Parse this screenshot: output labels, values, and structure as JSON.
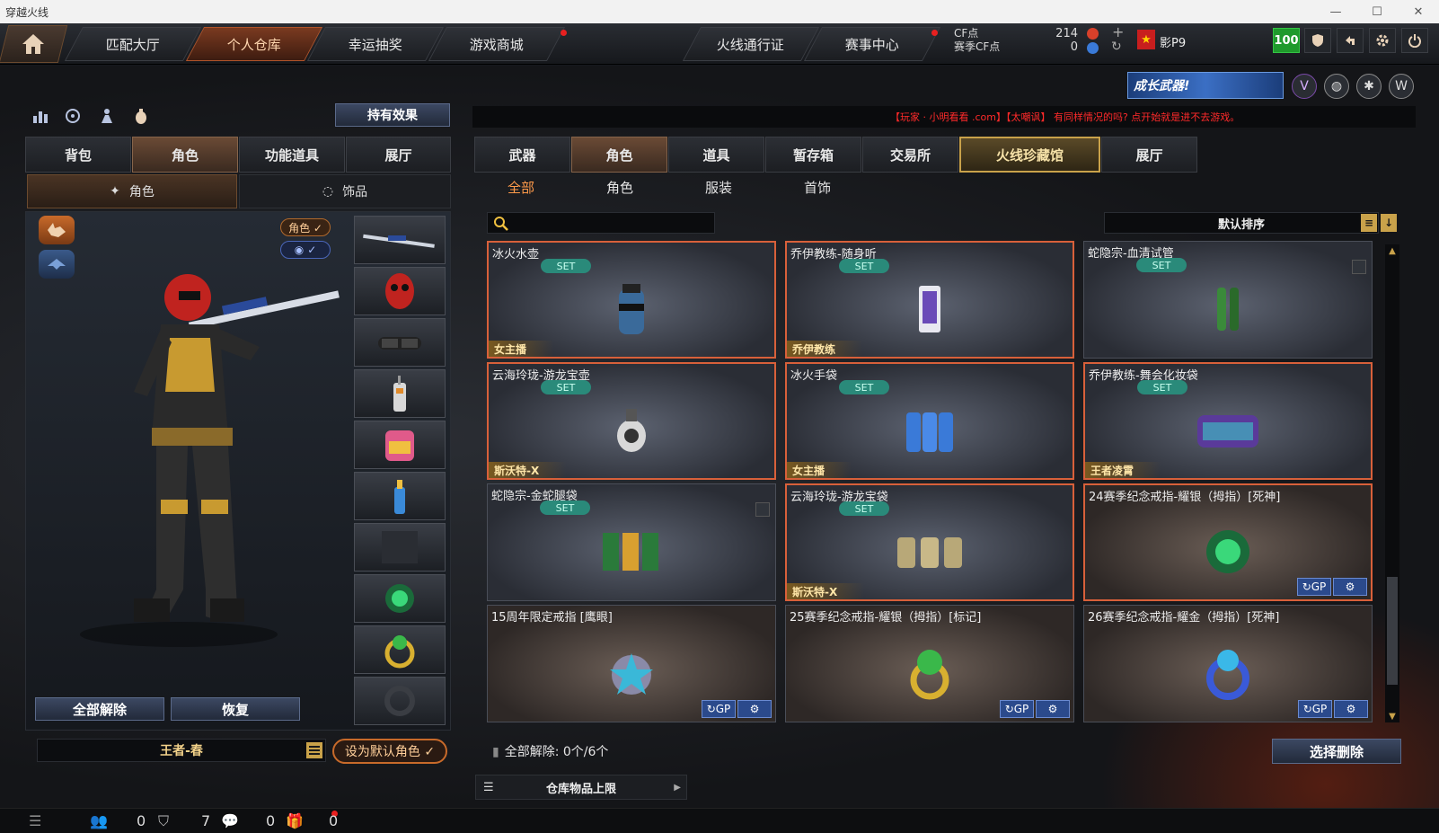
{
  "window": {
    "title": "穿越火线"
  },
  "topnav": {
    "tabs": [
      "匹配大厅",
      "个人仓库",
      "幸运抽奖",
      "游戏商城",
      "火线通行证",
      "赛事中心"
    ],
    "cf_label": "CF点",
    "season_cf_label": "赛季CF点",
    "cf_value": "214",
    "season_cf_value": "0",
    "rank_name": "影P9",
    "level": "100"
  },
  "left": {
    "hold_effect": "持有效果",
    "tabs": [
      "背包",
      "角色",
      "功能道具",
      "展厅"
    ],
    "subtabs": [
      "角色",
      "饰品"
    ],
    "badge_role": "角色 ✓",
    "badge_view": "✓",
    "release_all": "全部解除",
    "restore": "恢复",
    "character_name": "王者-春",
    "set_default": "设为默认角色 ✓"
  },
  "right": {
    "banner": "成长武器!",
    "marquee": "【玩家 · 小明看看 .com】【太嘲讽】 有同样情况的吗? 点开始就是进不去游戏。",
    "tabs": [
      "武器",
      "角色",
      "道具",
      "暂存箱",
      "交易所",
      "火线珍藏馆",
      "展厅"
    ],
    "subtabs": [
      "全部",
      "角色",
      "服装",
      "首饰"
    ],
    "sort_label": "默认排序",
    "release_status": "全部解除: 0个/6个",
    "choose_delete": "选择删除",
    "capacity": "仓库物品上限"
  },
  "items": [
    {
      "name": "冰火水壶",
      "set": "SET",
      "owner": "女主播"
    },
    {
      "name": "乔伊教练-随身听",
      "set": "SET",
      "owner": "乔伊教练"
    },
    {
      "name": "蛇隐宗-血清试管",
      "set": "SET",
      "owner": ""
    },
    {
      "name": "云海玲珑-游龙宝壶",
      "set": "SET",
      "owner": "斯沃特-X"
    },
    {
      "name": "冰火手袋",
      "set": "SET",
      "owner": "女主播"
    },
    {
      "name": "乔伊教练-舞会化妆袋",
      "set": "SET",
      "owner": "王者凌霄"
    },
    {
      "name": "蛇隐宗-金蛇腿袋",
      "set": "SET",
      "owner": ""
    },
    {
      "name": "云海玲珑-游龙宝袋",
      "set": "SET",
      "owner": "斯沃特-X"
    },
    {
      "name": "24赛季纪念戒指-耀银（拇指）[死神]",
      "set": "",
      "owner": ""
    },
    {
      "name": "15周年限定戒指 [鹰眼]",
      "set": "",
      "owner": ""
    },
    {
      "name": "25赛季纪念戒指-耀银（拇指）[标记]",
      "set": "",
      "owner": ""
    },
    {
      "name": "26赛季纪念戒指-耀金（拇指）[死神]",
      "set": "",
      "owner": ""
    }
  ],
  "card_buttons": {
    "gp": "↻GP",
    "gear": "⚙"
  },
  "status": {
    "v1": "0",
    "v2": "7",
    "v3": "0",
    "v4": "0"
  },
  "colors": {
    "accent": "#ff9a4a",
    "active_tab": "#6a4a35",
    "gold": "#c9a24a",
    "highlight_border": "#d8603a",
    "set_badge": "#2a8a7a"
  }
}
